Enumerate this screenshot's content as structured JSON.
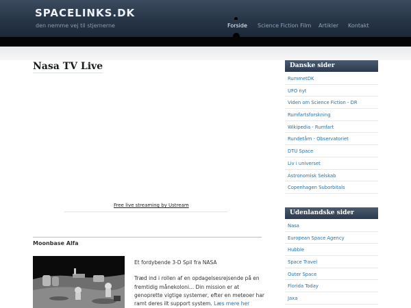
{
  "header": {
    "logo": "SPACELINKS.DK",
    "tagline": "den nemme vej til stjernerne",
    "nav": [
      {
        "label": "Forside",
        "active": true
      },
      {
        "label": "Science Fiction Film",
        "active": false
      },
      {
        "label": "Artikler",
        "active": false
      },
      {
        "label": "Kontakt",
        "active": false
      }
    ]
  },
  "main": {
    "title": "Nasa TV Live",
    "stream_link": "Free live streaming by Ustream",
    "post": {
      "title": "Moonbase Alfa",
      "lead": "Et fordybende 3-D Spil fra NASA",
      "body": "Træd ind i rollen af en opdagelsesrejsende på en fremtidig månekoloni... Din mission er at genoprette vigtige systemer, efter en meteoer har ramt deres ilt support system.",
      "read_more": "Læs mere her"
    }
  },
  "sidebar": {
    "danish": {
      "title": "Danske sider",
      "links": [
        "RummetDK",
        "UFO nyt",
        "Viden om Science Fiction - DR",
        "Rumfartsforskning",
        "Wikipedia - Rumfart",
        "Rundetårn - Observatoriet",
        "DTU Space",
        "Liv i universet",
        "Astronomisk Selskab",
        "Copenhagen Suborbitals"
      ]
    },
    "foreign": {
      "title": "Udenlandske sider",
      "links": [
        "Nasa",
        "European Space Agency",
        "Hubble",
        "Space Travel",
        "Outer Space",
        "Florida Today",
        "Jaxa"
      ]
    }
  },
  "colors": {
    "header_bg": "#273547",
    "link": "#2472a8",
    "widget_title_bg": "#2b3a4e"
  }
}
